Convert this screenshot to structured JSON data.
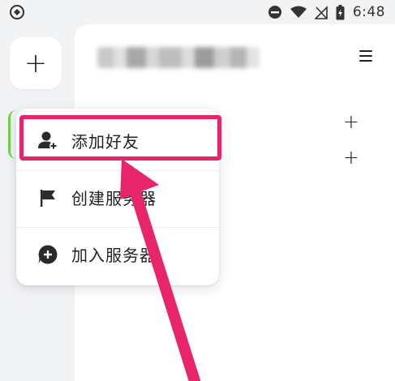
{
  "status_bar": {
    "time": "6:48",
    "icons": [
      "app-logo-icon",
      "dnd-icon",
      "wifi-icon",
      "no-signal-icon",
      "battery-charging-icon"
    ]
  },
  "server_rail": {
    "add_label": "+"
  },
  "panel": {
    "username": "",
    "add_buttons": [
      "+",
      "+"
    ]
  },
  "popup_menu": {
    "items": [
      {
        "label": "添加好友",
        "icon": "add-friend-icon"
      },
      {
        "label": "创建服务器",
        "icon": "flag-icon"
      },
      {
        "label": "加入服务器",
        "icon": "plus-circle-icon"
      }
    ]
  },
  "colors": {
    "highlight": "#e8256b",
    "active_indicator": "#6fd34a",
    "background": "#f2f3f5"
  }
}
